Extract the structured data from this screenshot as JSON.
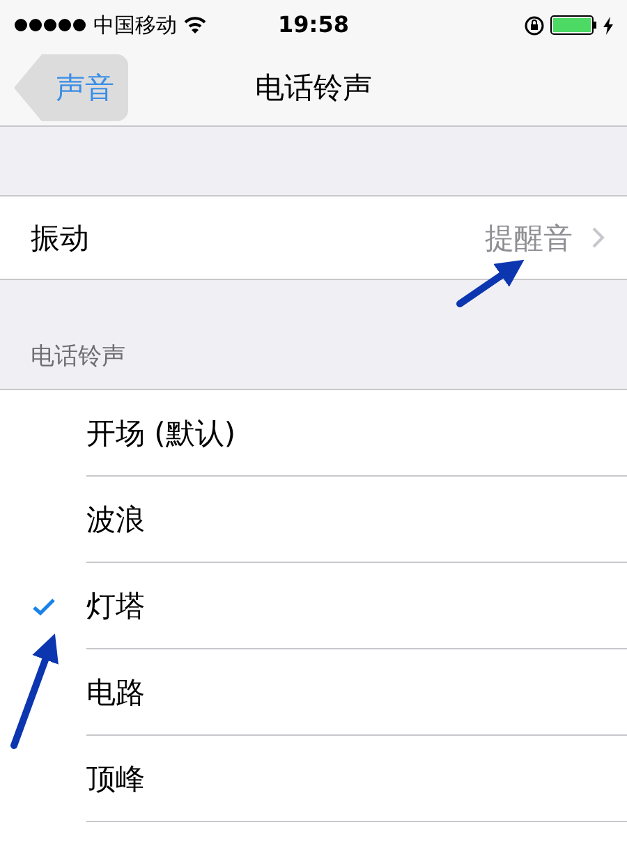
{
  "status_bar": {
    "carrier": "中国移动",
    "time": "19:58"
  },
  "nav_bar": {
    "back": "声音",
    "title": "电话铃声"
  },
  "vibration": {
    "label": "振动",
    "value": "提醒音"
  },
  "section": {
    "header": "电话铃声"
  },
  "ringtones": [
    {
      "label": "开场 (默认)",
      "selected": false
    },
    {
      "label": "波浪",
      "selected": false
    },
    {
      "label": "灯塔",
      "selected": true
    },
    {
      "label": "电路",
      "selected": false
    },
    {
      "label": "顶峰",
      "selected": false
    }
  ]
}
